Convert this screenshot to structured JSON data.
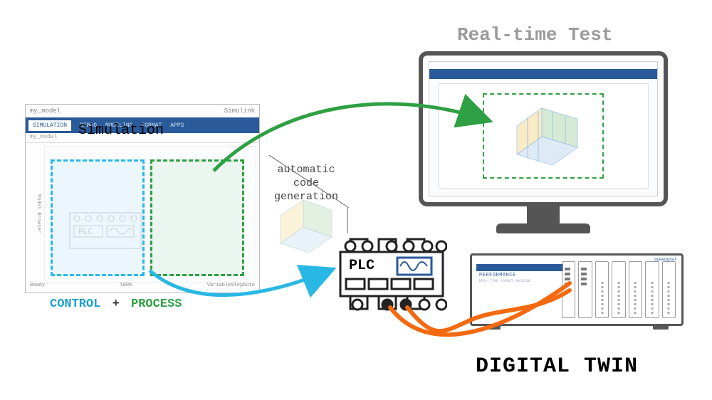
{
  "title_realtime": "Real-time Test",
  "simulation_label": "Simulation",
  "control_label": "CONTROL",
  "process_label": "PROCESS",
  "plus": "+",
  "codegen": {
    "l1": "automatic",
    "l2": "code",
    "l3": "generation"
  },
  "plc_label": "PLC",
  "digital_twin": "DIGITAL TWIN",
  "window": {
    "title_left": "my_model",
    "title_right": "Simulink",
    "ribbon": {
      "t1": "SIMULATION",
      "t2": "DEBUG",
      "t3": "MODELING",
      "t4": "FORMAT",
      "t5": "APPS"
    },
    "breadcrumb": "my_model",
    "side_label": "Model Browser",
    "footer_left": "Ready",
    "footer_mid": "100%",
    "footer_right": "VariableStepAuto"
  },
  "chassis": {
    "brand": "PERFORMANCE",
    "subtitle": "REAL-TIME TARGET MACHINE",
    "vendor": "speedgoat"
  },
  "colors": {
    "green": "#2ea043",
    "cyan": "#29b8e4",
    "orange": "#f36a10",
    "navy": "#2a5a9a",
    "grey": "#555555"
  }
}
